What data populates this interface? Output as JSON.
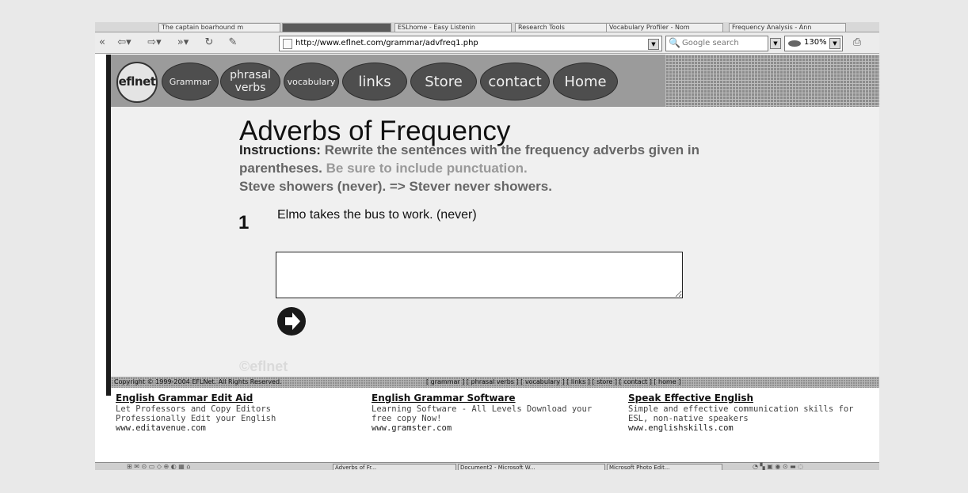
{
  "browser": {
    "tabs": [
      "The captain boarhound m",
      "",
      "ESLhome - Easy Listenin",
      "Research Tools",
      "Vocabulary Profiler - Nom",
      "Frequency Analysis - Ann"
    ],
    "url": "http://www.eflnet.com/grammar/advfreq1.php",
    "search_placeholder": "Google search",
    "zoom": "130%"
  },
  "nav": {
    "logo": "eflnet",
    "items": [
      "Grammar",
      "phrasal verbs",
      "vocabulary",
      "links",
      "Store",
      "contact",
      "Home"
    ]
  },
  "exercise": {
    "title": "Adverbs of Frequency",
    "instructions_label": "Instructions:",
    "instructions_text": "Rewrite the sentences with the frequency adverbs given in parentheses.",
    "instructions_extra": "Be sure to include punctuation.",
    "example": "Steve showers (never). => Stever never showers.",
    "question_number": "1",
    "question": "Elmo takes the bus to work. (never)",
    "answer_value": "",
    "watermark": "©eflnet"
  },
  "footer": {
    "copyright": "Copyright © 1999-2004 EFLNet. All Rights Reserved.",
    "links": "[ grammar ] [ phrasal verbs ] [ vocabulary ] [ links ] [ store ] [ contact ] [ home ]"
  },
  "ads": [
    {
      "headline": "English Grammar Edit Aid",
      "line1": "Let Professors and Copy Editors",
      "line2": "Professionally Edit your English",
      "url": "www.editavenue.com"
    },
    {
      "headline": "English Grammar Software",
      "line1": "Learning Software - All Levels Download your",
      "line2": "free copy Now!",
      "url": "www.gramster.com"
    },
    {
      "headline": "Speak Effective English",
      "line1": "Simple and effective communication skills for",
      "line2": "ESL, non-native speakers",
      "url": "www.englishskills.com"
    }
  ],
  "taskbar": {
    "items": [
      "Adverbs of Fr...",
      "Document2 - Microsoft W...",
      "Microsoft Photo Edit..."
    ]
  }
}
